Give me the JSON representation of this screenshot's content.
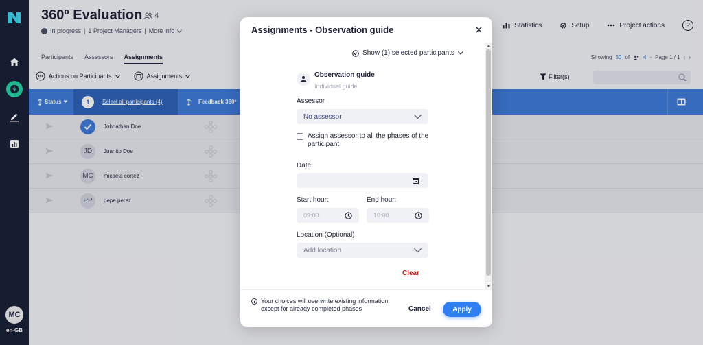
{
  "app": {
    "language": "en-GB",
    "user_initials": "MC"
  },
  "project": {
    "title": "360º Evaluation",
    "participant_count": "4",
    "status": "In progress",
    "managers": "1 Project Managers",
    "more_info": "More info"
  },
  "header_actions": {
    "statistics": "Statistics",
    "setup": "Setup",
    "project_actions": "Project actions",
    "help": "?"
  },
  "tabs": [
    {
      "label": "Participants"
    },
    {
      "label": "Assessors"
    },
    {
      "label": "Assignments",
      "active": true
    }
  ],
  "paging": {
    "showing": "Showing",
    "per_page": "50",
    "of": "of",
    "count": "4",
    "page": "Page 1 / 1"
  },
  "toolbar": {
    "actions_on_participants": "Actions on Participants",
    "assignments": "Assignments",
    "filter": "Filter(s)"
  },
  "table": {
    "status_header": "Status",
    "selected_count": "1",
    "select_all": "Select all participants (4)",
    "feedback_header": "Feedback 360º",
    "rows": [
      {
        "initials": "",
        "name": "Johnathan Doe",
        "selected": true
      },
      {
        "initials": "JD",
        "name": "Juanito Doe",
        "selected": false
      },
      {
        "initials": "MC",
        "name": "micaela cortez",
        "selected": false
      },
      {
        "initials": "PP",
        "name": "pepe perez",
        "selected": false
      }
    ]
  },
  "modal": {
    "title": "Assignments - Observation guide",
    "show_selected": "Show (1) selected participants",
    "guide_title": "Observation guide",
    "guide_subtitle": "Individual guide",
    "assessor_label": "Assessor",
    "assessor_value": "No assessor",
    "assign_all_label": "Assign assessor to all the phases of the participant",
    "date_label": "Date",
    "start_hour_label": "Start hour:",
    "start_hour_placeholder": "09:00",
    "end_hour_label": "End hour:",
    "end_hour_placeholder": "10:00",
    "location_label": "Location (Optional)",
    "location_placeholder": "Add location",
    "clear": "Clear",
    "notice": "Your choices will overwrite existing information, except for already completed phases",
    "cancel": "Cancel",
    "apply": "Apply"
  },
  "colors": {
    "rail": "#1b2238",
    "accent": "#26d3a7",
    "table_header": "#3f7bd9",
    "apply": "#2f7ff0",
    "danger": "#c0241c"
  },
  "icons": [
    "logo-icon",
    "home-icon",
    "bolt-icon",
    "edit-icon",
    "chart-icon",
    "users-icon",
    "bar-chart-icon",
    "gear-icon",
    "dots-icon",
    "help-icon",
    "chevron-down-icon",
    "calendar-icon",
    "clock-icon",
    "close-icon",
    "person-icon",
    "info-icon",
    "filter-icon",
    "send-icon",
    "check-icon",
    "columns-icon",
    "search-icon"
  ]
}
